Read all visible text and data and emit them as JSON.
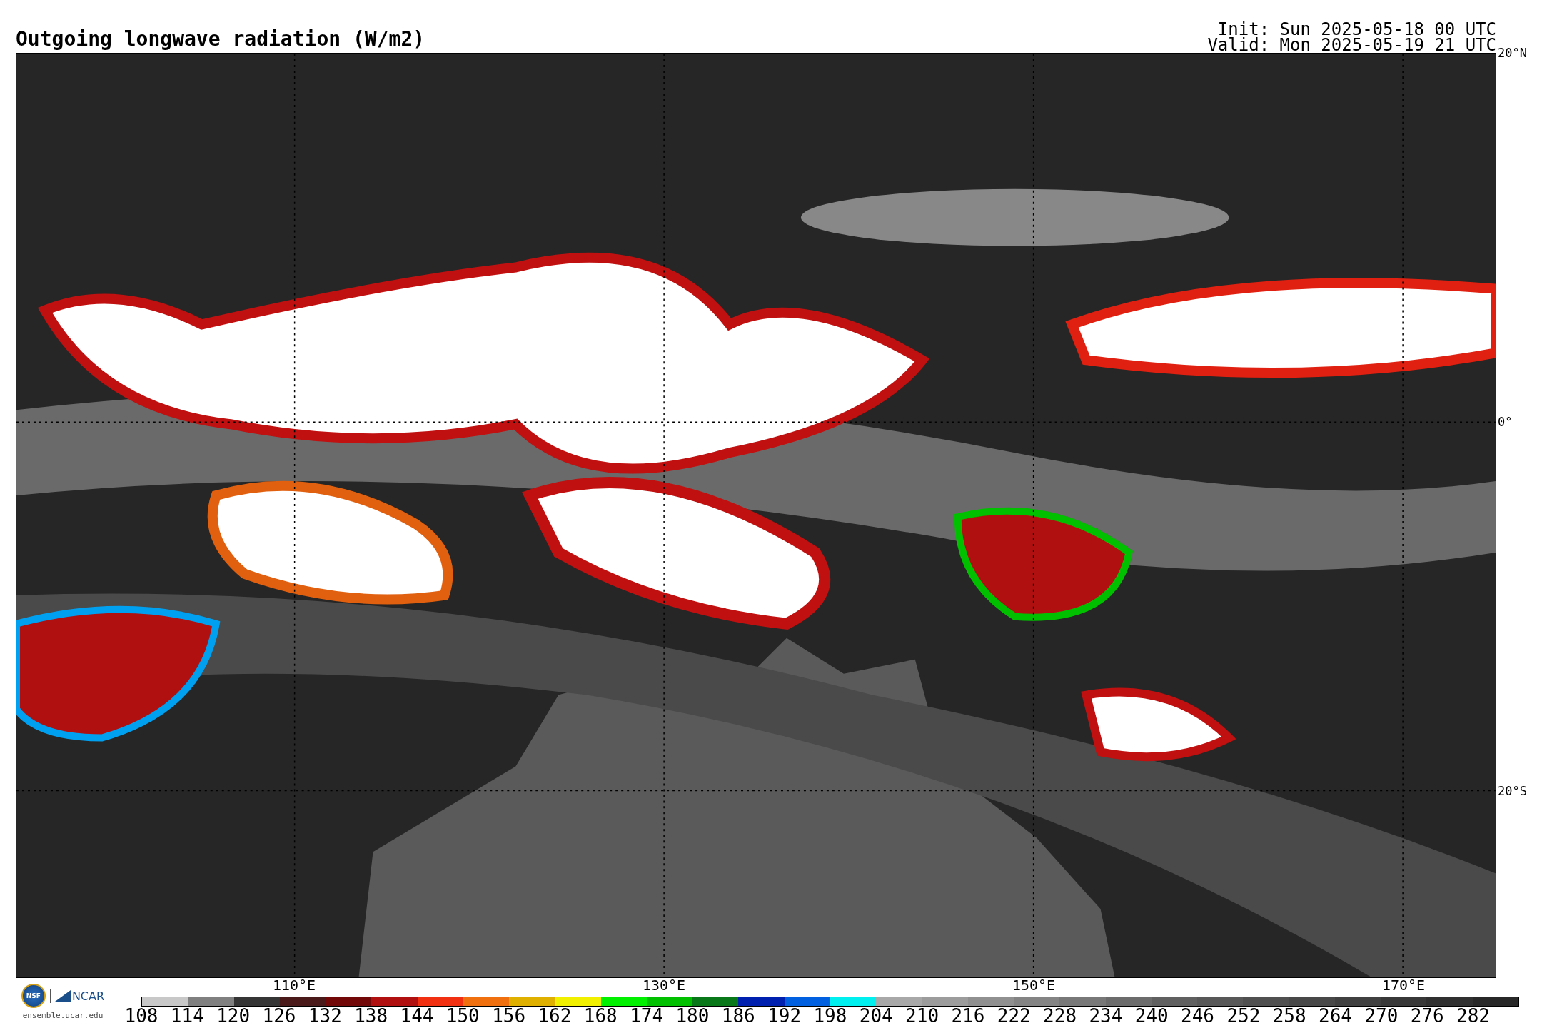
{
  "title": "Outgoing longwave radiation (W/m2)",
  "run_info": [
    "Init: Sun 2025-05-18 00 UTC",
    "Valid: Mon 2025-05-19 21 UTC"
  ],
  "map": {
    "latitude_labels": [
      "20°N",
      "0°",
      "20°S"
    ],
    "longitude_labels": [
      "110°E",
      "130°E",
      "150°E",
      "170°E"
    ]
  },
  "logo": {
    "emblem": "NSF",
    "name": "NCAR",
    "url": "ensemble.ucar.edu"
  },
  "colorbar": [
    {
      "label": "108",
      "color": "#c8c8c8"
    },
    {
      "label": "114",
      "color": "#808080"
    },
    {
      "label": "120",
      "color": "#353535"
    },
    {
      "label": "126",
      "color": "#4a1a1a"
    },
    {
      "label": "132",
      "color": "#730808"
    },
    {
      "label": "138",
      "color": "#b01010"
    },
    {
      "label": "144",
      "color": "#f03010"
    },
    {
      "label": "150",
      "color": "#f07010"
    },
    {
      "label": "156",
      "color": "#e0b000"
    },
    {
      "label": "162",
      "color": "#f0f000"
    },
    {
      "label": "168",
      "color": "#00f000"
    },
    {
      "label": "174",
      "color": "#00c000"
    },
    {
      "label": "180",
      "color": "#087818"
    },
    {
      "label": "186",
      "color": "#0020b0"
    },
    {
      "label": "192",
      "color": "#0060e0"
    },
    {
      "label": "198",
      "color": "#00f0f0"
    },
    {
      "label": "204",
      "color": "#a8a8a8"
    },
    {
      "label": "210",
      "color": "#9c9c9c"
    },
    {
      "label": "216",
      "color": "#909090"
    },
    {
      "label": "222",
      "color": "#848484"
    },
    {
      "label": "228",
      "color": "#787878"
    },
    {
      "label": "234",
      "color": "#6c6c6c"
    },
    {
      "label": "240",
      "color": "#606060"
    },
    {
      "label": "246",
      "color": "#585858"
    },
    {
      "label": "252",
      "color": "#505050"
    },
    {
      "label": "258",
      "color": "#484848"
    },
    {
      "label": "264",
      "color": "#404040"
    },
    {
      "label": "270",
      "color": "#383838"
    },
    {
      "label": "276",
      "color": "#303030"
    },
    {
      "label": "282",
      "color": "#282828"
    }
  ]
}
